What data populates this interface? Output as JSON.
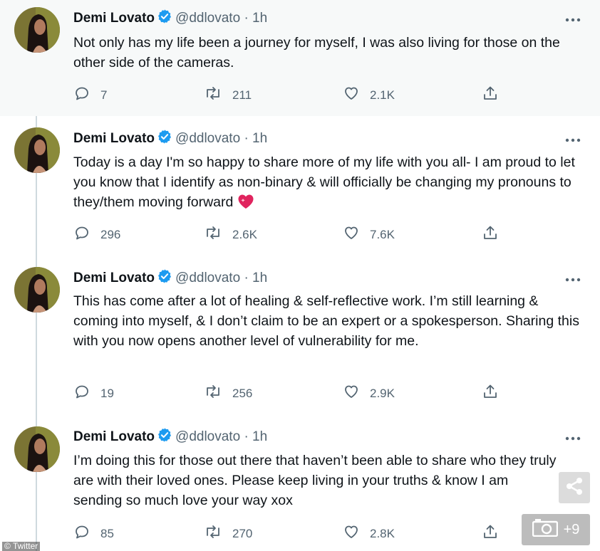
{
  "colors": {
    "accent": "#1d9bf0",
    "muted": "#536471",
    "highlight_bg": "#f7f9f9"
  },
  "author": {
    "name": "Demi Lovato",
    "handle": "@ddlovato",
    "verified": true
  },
  "tweets": [
    {
      "dot": "·",
      "time": "1h",
      "text": "Not only has my life been a journey for myself,  I was also living for those on the other side of the cameras.",
      "replies": "7",
      "retweets": "211",
      "likes": "2.1K"
    },
    {
      "dot": "·",
      "time": "1h",
      "text": "Today is a day I'm so happy to share more of my life with you all- I am proud to let you know that I identify as non-binary & will officially be changing my pronouns to they/them moving forward",
      "emoji": "heart-emoji",
      "replies": "296",
      "retweets": "2.6K",
      "likes": "7.6K"
    },
    {
      "dot": "·",
      "time": "1h",
      "text": "This has come after a lot of healing & self-reflective work. I’m still learning & coming into myself, & I don’t claim to be an expert or a spokesperson. Sharing this with you now opens another level of vulnerability for me.",
      "replies": "19",
      "retweets": "256",
      "likes": "2.9K"
    },
    {
      "dot": "·",
      "time": "1h",
      "text": "I’m doing this for those out there that haven’t been able to share who they truly are with their loved ones. Please keep living in your truths & know I am sending so much love your way xox",
      "replies": "85",
      "retweets": "270",
      "likes": "2.8K"
    }
  ],
  "overlay": {
    "gallery_count": "+9",
    "credit": "© Twitter",
    "share_icon": "share-icon",
    "camera_icon": "camera-icon"
  }
}
